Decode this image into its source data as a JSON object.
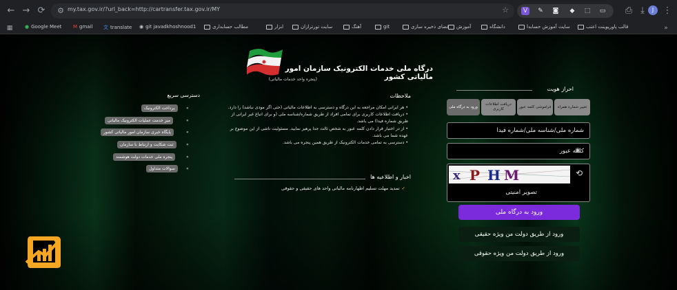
{
  "browser": {
    "url": "my.tax.gov.ir/?url_back=http://cartransfer.tax.gov.ir/MY",
    "profile_initial": "J",
    "bookmarks": [
      "Google Meet",
      "gmail",
      "translate",
      "git javadkhoshnood1",
      "مطالب حسابداری",
      "ابزار",
      "سایت تورترازان",
      "آهنگ",
      "git",
      "فضای ذخیره سازی",
      "آموزش",
      "دانشگاه",
      "سایت آموزش حسابدا",
      "قالب پاورپوینت اعتب"
    ]
  },
  "header": {
    "title": "درگاه ملی خدمات الکترونیک سازمان امور مالیاتی کشور",
    "subtitle": "(پنجره واحد خدمات مالیاتی)"
  },
  "auth": {
    "title": "احراز هویت",
    "tabs": [
      {
        "label": "تغییر شماره همراه",
        "active": false
      },
      {
        "label": "فراموشی کلمه عبور",
        "active": false
      },
      {
        "label": "دریافت اطلاعات کاربری",
        "active": false
      },
      {
        "label": "ورود به درگاه ملی",
        "active": true
      }
    ],
    "username_placeholder": "شماره ملی/شناسه ملی/شماره فیدا",
    "password_placeholder": "کلمه عبور",
    "captcha_text": "xPHM",
    "captcha_label": "تصویر امنیتی",
    "login_button": "ورود به درگاه ملی",
    "alt_login_real": "ورود از طریق دولت من ویژه حقیقی",
    "alt_login_legal": "ورود از طریق دولت من ویژه حقوقی"
  },
  "notes": {
    "title": "ملاحظات",
    "items": [
      "• هر ایرانی امکان مراجعه به این درگاه و دسترسی به اطلاعات مالیاتی (حتی اگر مودی نباشد) را دارد.",
      "• دریافت اطلاعات کاربری برای تمامی افراد از طریق شماره/شناسه ملی (و برای اتباع غیر ایرانی از طریق شماره فیدا) می باشد.",
      "• از در اختیار قرار دادن کلمه عبور به شخص ثالث جدا پرهیز نمایید. مسئولیت ناشی از این موضوع بر عهده شما می باشد.",
      "• دسترسی به تمامی خدمات الکترونیک از طریق همین پنجره می باشد."
    ]
  },
  "news": {
    "title": "اخبار و اطلاعیه ها",
    "items": [
      "تمدید مهلت تسلیم اظهارنامه مالیاتی واحد های حقیقی و حقوقی"
    ]
  },
  "quick_access": {
    "title": "دسترسی سریع",
    "items": [
      "پرداخت الکترونیک",
      "میز خدمت عملیات الکترونیک مالیاتی",
      "پایگاه خبری سازمان امور مالیاتی کشور",
      "ثبت شکایت و ارتباط با سازمان",
      "پنجره ملی خدمات دولت هوشمند",
      "سوالات متداول"
    ]
  },
  "colors": {
    "primary_button": "#7b2bdb",
    "tab_bg": "#8a8a8a",
    "quick_item_bg": "#6b6b6b",
    "logo_orange": "#f5a623"
  }
}
